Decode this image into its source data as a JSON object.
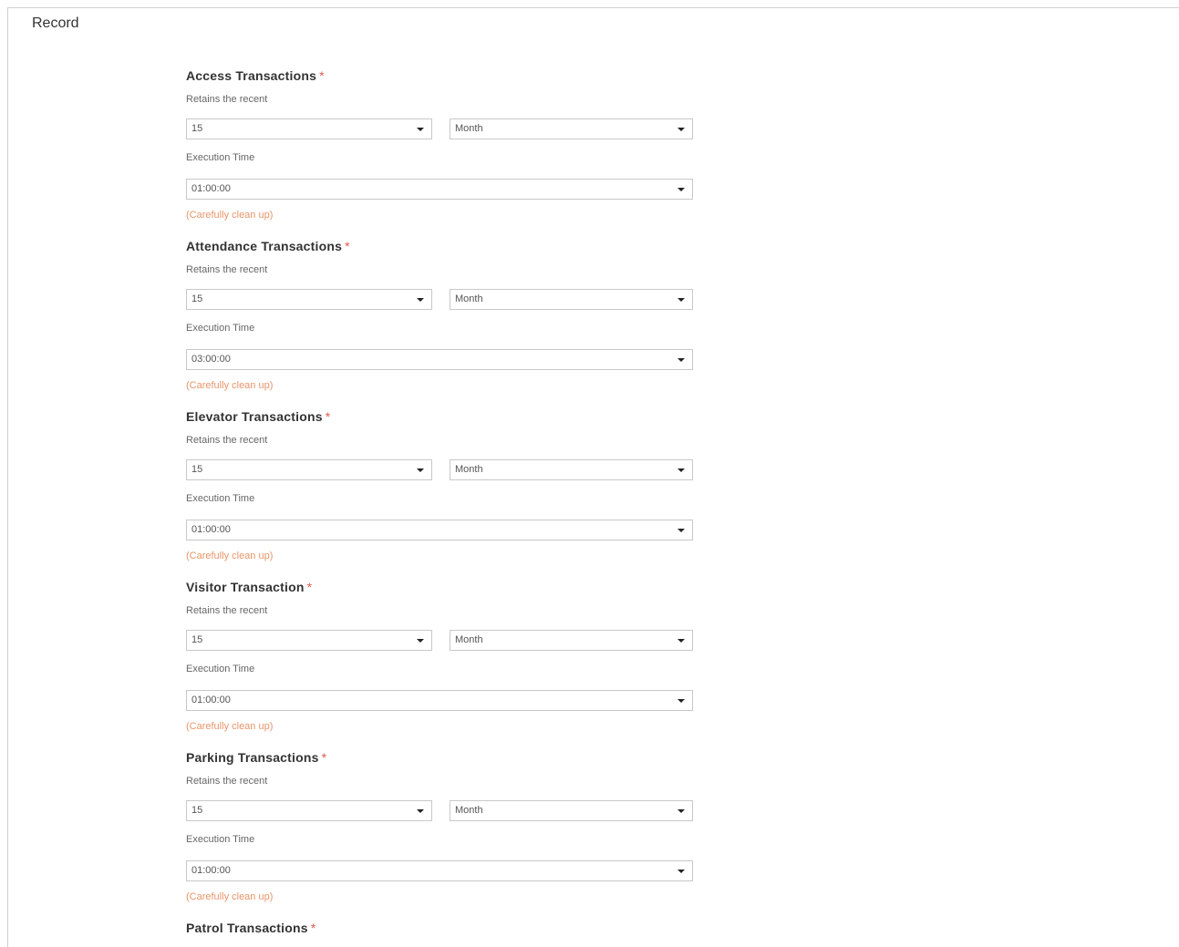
{
  "panel": {
    "title": "Record"
  },
  "labels": {
    "retains": "Retains the recent",
    "execution": "Execution Time",
    "hint": "(Carefully clean up)",
    "required": "*"
  },
  "sections": [
    {
      "title": "Access Transactions",
      "count": "15",
      "unit": "Month",
      "time": "01:00:00"
    },
    {
      "title": "Attendance Transactions",
      "count": "15",
      "unit": "Month",
      "time": "03:00:00"
    },
    {
      "title": "Elevator Transactions",
      "count": "15",
      "unit": "Month",
      "time": "01:00:00"
    },
    {
      "title": "Visitor Transaction",
      "count": "15",
      "unit": "Month",
      "time": "01:00:00"
    },
    {
      "title": "Parking Transactions",
      "count": "15",
      "unit": "Month",
      "time": "01:00:00"
    },
    {
      "title": "Patrol Transactions"
    }
  ],
  "colors": {
    "required": "#e05a4f",
    "hint": "#e8956a",
    "border": "#c8c8c8"
  },
  "icons": {
    "dropdown": "caret-down-icon"
  }
}
